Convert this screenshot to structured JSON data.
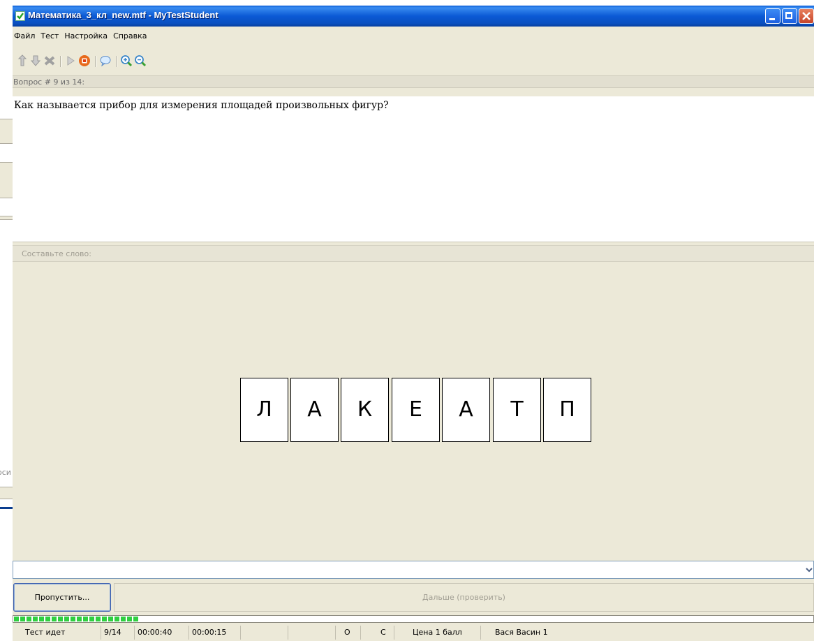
{
  "window": {
    "title": "Математика_3_кл_new.mtf - MyTestStudent",
    "background_fragment": "оси"
  },
  "menu": [
    "Файл",
    "Тест",
    "Настройка",
    "Справка"
  ],
  "toolbar": {
    "icons": [
      "upload-icon",
      "download-icon",
      "delete-icon",
      "play-icon",
      "stop-icon",
      "speech-icon",
      "zoom-in-icon",
      "zoom-out-icon"
    ]
  },
  "question": {
    "label": "Вопрос # 9 из 14:",
    "text": "Как называется прибор для измерения площадей произвольных фигур?"
  },
  "answer": {
    "label": "Составьте слово:",
    "letters": [
      "Л",
      "А",
      "К",
      "Е",
      "А",
      "Т",
      "П"
    ],
    "input_value": ""
  },
  "buttons": {
    "skip": "Пропустить...",
    "next": "Дальше (проверить)"
  },
  "progress": {
    "fraction": 0.156
  },
  "status": {
    "state": "Тест идет",
    "counter": "9/14",
    "time_total": "00:00:40",
    "time_question": "00:00:15",
    "blank1": "",
    "blank2": "",
    "flag_o": "O",
    "flag_c": "C",
    "price": "Цена 1 балл",
    "user": "Вася Васин 1"
  },
  "colors": {
    "titlebar": "#0b5ad5",
    "progress": "#2fcf40",
    "window_bg": "#ece9d8"
  }
}
